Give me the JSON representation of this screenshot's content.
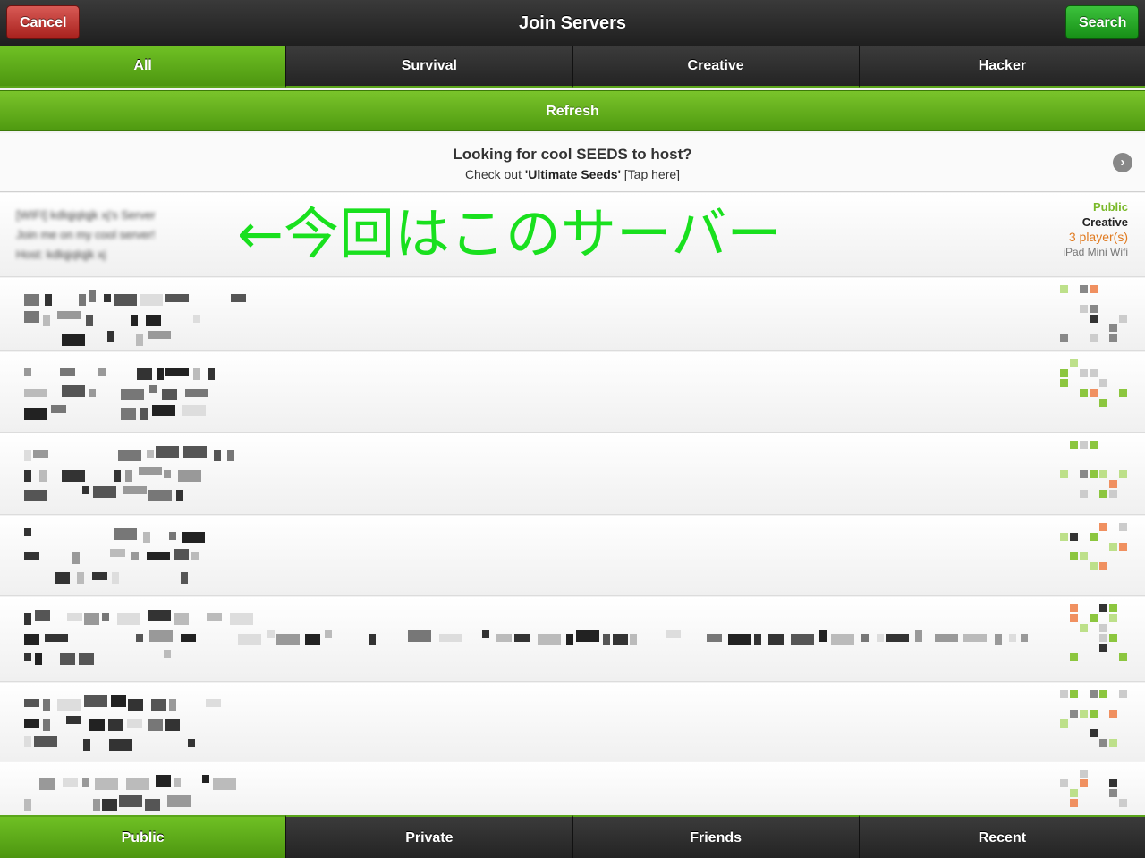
{
  "header": {
    "title": "Join Servers",
    "cancel_label": "Cancel",
    "search_label": "Search"
  },
  "filter_tabs": [
    {
      "label": "All",
      "active": true
    },
    {
      "label": "Survival",
      "active": false
    },
    {
      "label": "Creative",
      "active": false
    },
    {
      "label": "Hacker",
      "active": false
    }
  ],
  "refresh_label": "Refresh",
  "promo": {
    "title": "Looking for cool SEEDS to host?",
    "sub_prefix": "Check out ",
    "sub_bold": "'Ultimate Seeds'",
    "sub_suffix": " [Tap here]"
  },
  "featured_server": {
    "line1": "[WIFI] kdlqjqlqjk xj's Server",
    "line2": "Join me on my cool server!",
    "line3": "Host: kdlqjqlqjk xj",
    "type": "Public",
    "mode": "Creative",
    "players": "3 player(s)",
    "device": "iPad Mini Wifi"
  },
  "annotation_text": "←今回はこのサーバー",
  "bottom_tabs": [
    {
      "label": "Public",
      "active": true
    },
    {
      "label": "Private",
      "active": false
    },
    {
      "label": "Friends",
      "active": false
    },
    {
      "label": "Recent",
      "active": false
    }
  ],
  "colors": {
    "accent_green": "#5aa51a",
    "cancel_red": "#c0392b",
    "search_green": "#22a322",
    "annotation_green": "#19e01e",
    "players_orange": "#e07a1f"
  }
}
